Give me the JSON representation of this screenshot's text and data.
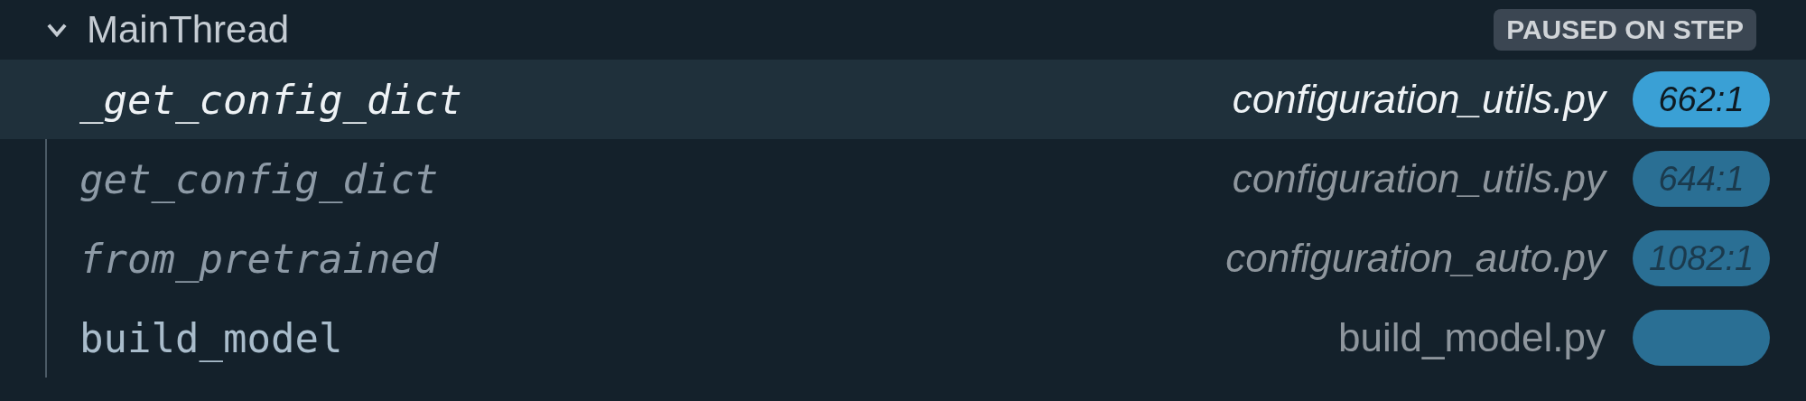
{
  "thread": {
    "name": "MainThread",
    "expanded": true,
    "status": "PAUSED ON STEP"
  },
  "frames": [
    {
      "name": "_get_config_dict",
      "file": "configuration_utils.py",
      "line": "662:1",
      "selected": true,
      "italic": true
    },
    {
      "name": "get_config_dict",
      "file": "configuration_utils.py",
      "line": "644:1",
      "selected": false,
      "italic": true
    },
    {
      "name": "from_pretrained",
      "file": "configuration_auto.py",
      "line": "1082:1",
      "selected": false,
      "italic": true
    },
    {
      "name": "build_model",
      "file": "build_model.py",
      "selected": false,
      "italic": false
    }
  ]
}
